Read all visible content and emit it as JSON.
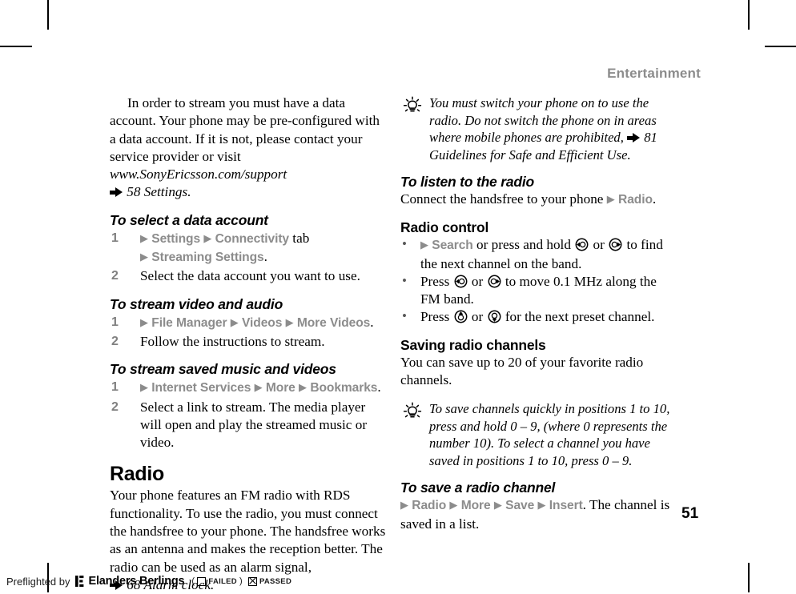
{
  "document": {
    "running_header": "Entertainment",
    "page_number": "51"
  },
  "left_column": {
    "intro": {
      "line1": "In order to stream you must have a data account. Your phone may be pre-configured with a data account. If it is not, please contact your service provider or visit ",
      "url": "www.SonyEricsson.com/support",
      "xref": "58 Settings."
    },
    "proc_data_account": {
      "heading": "To select a data account",
      "steps": [
        {
          "num": "1",
          "arrow1": "▶",
          "menu1": "Settings",
          "arrow2": "▶",
          "menu2": "Connectivity",
          "tail1": " tab",
          "arrow3": "▶",
          "menu3": "Streaming Settings",
          "tail2": "."
        },
        {
          "num": "2",
          "text": "Select the data account you want to use."
        }
      ]
    },
    "proc_stream_video": {
      "heading": "To stream video and audio",
      "steps": [
        {
          "num": "1",
          "arrow1": "▶",
          "menu1": "File Manager",
          "arrow2": "▶",
          "menu2": "Videos",
          "arrow3": "▶",
          "menu3": "More Videos",
          "tail": "."
        },
        {
          "num": "2",
          "text": "Follow the instructions to stream."
        }
      ]
    },
    "proc_stream_saved": {
      "heading": "To stream saved music and videos",
      "steps": [
        {
          "num": "1",
          "arrow1": "▶",
          "menu1": "Internet Services",
          "arrow2": "▶",
          "menu2": "More",
          "arrow3": "▶",
          "menu3": "Bookmarks",
          "tail": "."
        },
        {
          "num": "2",
          "text": "Select a link to stream. The media player will open and play the streamed music or video."
        }
      ]
    },
    "radio_section": {
      "heading": "Radio",
      "body": "Your phone features an FM radio with RDS functionality. To use the radio, you must connect the handsfree to your phone. The handsfree works as an antenna and makes the reception better. The radio can be used as an alarm signal,",
      "xref": "68 Alarm clock."
    }
  },
  "right_column": {
    "tip_switch_on": {
      "icon": "lightbulb-icon",
      "text_before": "You must switch your phone on to use the radio. Do not switch the phone on in areas where mobile phones are prohibited, ",
      "xref": "81 Guidelines for Safe and Efficient Use."
    },
    "proc_listen": {
      "heading": "To listen to the radio",
      "text_before": "Connect the handsfree to your phone ",
      "arrow": "▶",
      "menu": "Radio",
      "text_after": "."
    },
    "radio_control": {
      "heading": "Radio control",
      "bullets": [
        {
          "bullet": "•",
          "arrow": "▶",
          "menu": "Search",
          "text_mid": " or press and hold ",
          "icon_left": "nav-key-left-icon",
          "text_or": " or ",
          "icon_right": "nav-key-right-icon",
          "text_end": " to find the next channel on the band."
        },
        {
          "bullet": "•",
          "text_start": "Press ",
          "icon_left": "nav-key-left-icon",
          "text_or": " or ",
          "icon_right": "nav-key-right-icon",
          "text_end": " to move 0.1 MHz along the FM band."
        },
        {
          "bullet": "•",
          "text_start": "Press ",
          "icon_up": "nav-key-up-icon",
          "text_or": " or ",
          "icon_down": "nav-key-down-icon",
          "text_end": " for the next preset channel."
        }
      ]
    },
    "saving_channels": {
      "heading": "Saving radio channels",
      "body": "You can save up to 20 of your favorite radio channels."
    },
    "tip_save_quick": {
      "icon": "lightbulb-icon",
      "text": "To save channels quickly in positions 1 to 10, press and hold 0 – 9, (where 0 represents the number 10). To select a channel you have saved in positions 1 to 10, press 0 – 9."
    },
    "proc_save_channel": {
      "heading": "To save a radio channel",
      "arrow1": "▶",
      "menu1": "Radio",
      "arrow2": "▶",
      "menu2": "More",
      "arrow3": "▶",
      "menu3": "Save",
      "arrow4": "▶",
      "menu4": "Insert",
      "text_after": ". The channel is saved in a list."
    }
  },
  "footer": {
    "preflight_label": "Preflighted by",
    "brand": "Elanders Berlings",
    "paren_open": "(",
    "failed_label": "FAILED",
    "paren_close": ")",
    "passed_label": "PASSED"
  },
  "colors": {
    "menu_gray": "#8c8c8c",
    "header_gray": "#8c8c8c",
    "text_black": "#000000"
  }
}
